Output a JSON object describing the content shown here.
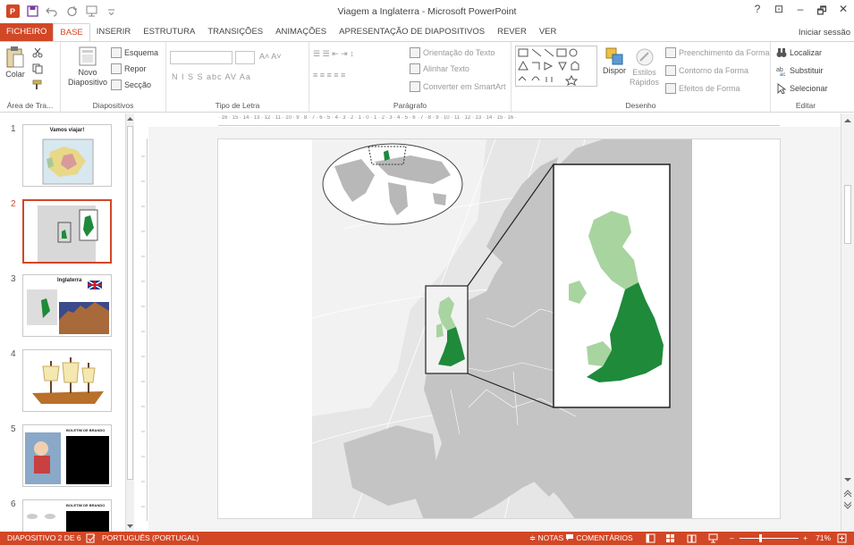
{
  "window": {
    "title": "Viagem a Inglaterra - Microsoft PowerPoint",
    "help": "?",
    "controls": [
      "⊡",
      "–",
      "🗗",
      "✕"
    ]
  },
  "tabs": [
    "FICHEIRO",
    "BASE",
    "INSERIR",
    "ESTRUTURA",
    "TRANSIÇÕES",
    "ANIMAÇÕES",
    "APRESENTAÇÃO DE DIAPOSITIVOS",
    "REVER",
    "VER"
  ],
  "signin": "Iniciar sessão",
  "ribbon": {
    "clipboard": {
      "label": "Área de Tra...",
      "paste": "Colar"
    },
    "slides": {
      "label": "Diapositivos",
      "new_line1": "Novo",
      "new_line2": "Diapositivo",
      "layout": "Esquema",
      "reset": "Repor",
      "section": "Secção"
    },
    "font": {
      "label": "Tipo de Letra",
      "format_row": "N  I  S  S  abc  AV  Aa"
    },
    "paragraph": {
      "label": "Parágrafo",
      "text_direction": "Orientação do Texto",
      "align_text": "Alinhar Texto",
      "smartart": "Converter em SmartArt"
    },
    "drawing": {
      "label": "Desenho",
      "arrange": "Dispor",
      "quick_styles_1": "Estilos",
      "quick_styles_2": "Rápidos",
      "shape_fill": "Preenchimento da Forma",
      "shape_outline": "Contorno da Forma",
      "shape_effects": "Efeitos de Forma"
    },
    "editing": {
      "label": "Editar",
      "find": "Localizar",
      "replace": "Substituir",
      "select": "Selecionar"
    }
  },
  "ruler_text": "· 16 · 15 · 14 · 13 · 12 · 11 · 10 · 9 · 8 · 7 · 6 · 5 · 4 · 3 · 2 · 1 · 0 · 1 · 2 · 3 · 4 · 5 · 6 · 7 · 8 · 9 · 10 · 11 · 12 · 13 · 14 · 15 · 16 ·",
  "slides": [
    {
      "num": "1",
      "title": "Vamos viajar!"
    },
    {
      "num": "2",
      "title": ""
    },
    {
      "num": "3",
      "title": "Inglaterra"
    },
    {
      "num": "4",
      "title": ""
    },
    {
      "num": "5",
      "title": "BOLETIM DE BRANDO"
    },
    {
      "num": "6",
      "title": "BOLETIM DE BRANDO"
    }
  ],
  "status": {
    "slide_info": "DIAPOSITIVO 2 DE 6",
    "language": "PORTUGUÊS (PORTUGAL)",
    "notes": "NOTAS",
    "comments": "COMENTÁRIOS",
    "zoom": "71%",
    "zoom_level": 0.71
  },
  "colors": {
    "accent": "#d24726",
    "england": "#1e8a3a",
    "uk_light": "#a8d4a0",
    "map_land": "#c9c9c9",
    "map_sea": "#ffffff"
  }
}
